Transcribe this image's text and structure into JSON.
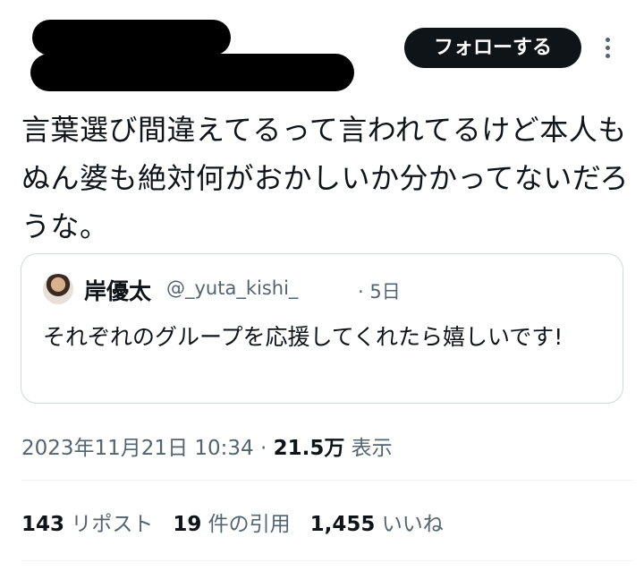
{
  "header": {
    "follow_label": "フォローする",
    "more_icon": "more-vertical-icon"
  },
  "tweet": {
    "text": "言葉選び間違えてるって言われてるけど本人もぬん婆も絶対何がおかしいか分かってないだろうな。"
  },
  "quote": {
    "name": "岸優太",
    "handle": "@_yuta_kishi_",
    "date": "· 5日",
    "text": "それぞれのグループを応援してくれたら嬉しいです!"
  },
  "meta": {
    "datetime": "2023年11月21日 10:34",
    "separator": "·",
    "views_count": "21.5万",
    "views_label": "表示"
  },
  "stats": {
    "reposts_count": "143",
    "reposts_label": "リポスト",
    "quotes_count": "19",
    "quotes_label": "件の引用",
    "likes_count": "1,455",
    "likes_label": "いいね"
  },
  "colors": {
    "text": "#0f1419",
    "secondary": "#536471",
    "border": "#cfd9de",
    "button_bg": "#0f1419"
  }
}
